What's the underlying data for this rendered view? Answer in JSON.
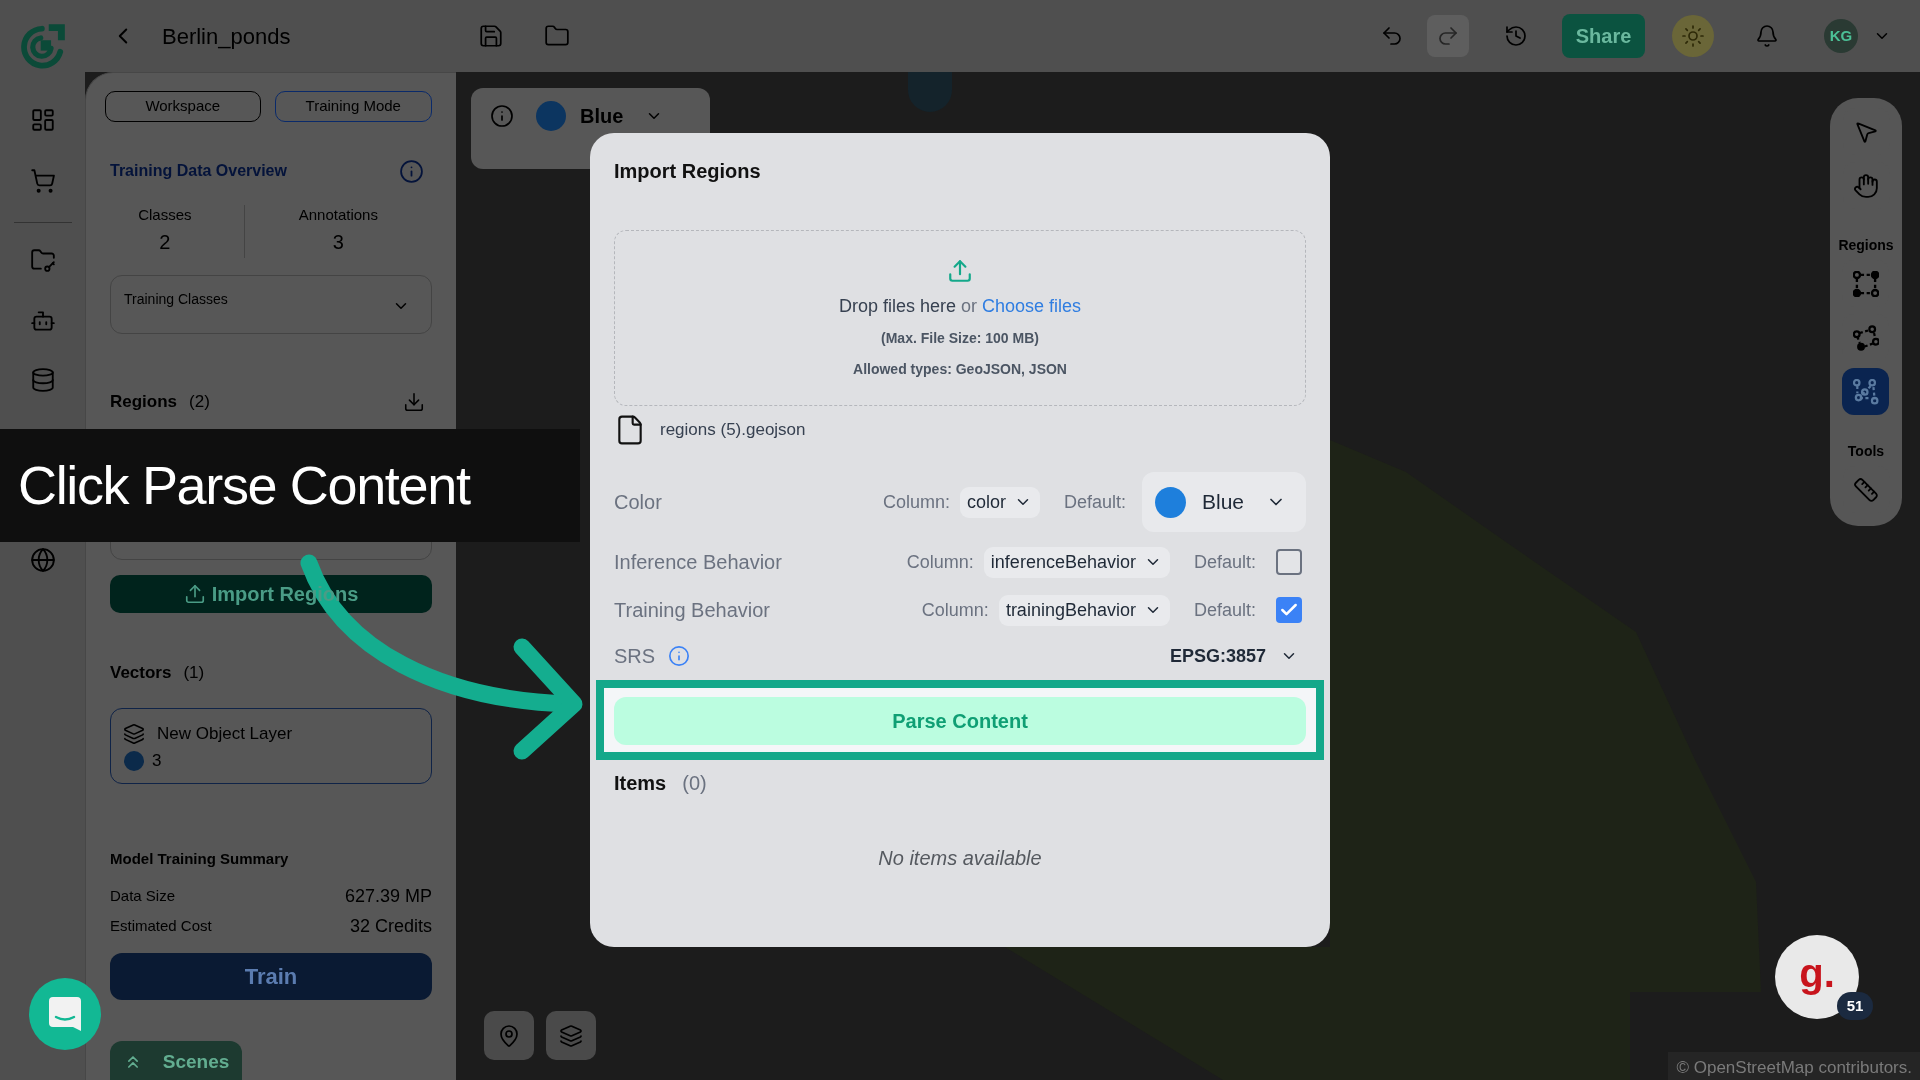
{
  "top_bar": {
    "project_title": "Berlin_ponds",
    "share_button": "Share",
    "user_initials": "KG"
  },
  "side_panel": {
    "mode_buttons": [
      {
        "label": "Workspace",
        "selected": false
      },
      {
        "label": "Training Mode",
        "selected": true
      }
    ],
    "overview": {
      "title": "Training Data Overview",
      "stats": [
        {
          "label": "Classes",
          "value": "2"
        },
        {
          "label": "Annotations",
          "value": "3"
        }
      ],
      "classes_dropdown": {
        "placeholder": "Training Classes"
      }
    },
    "regions": {
      "title": "Regions",
      "count": "(2)",
      "import_button": "Import Regions"
    },
    "vectors": {
      "title": "Vectors",
      "count": "(1)",
      "layers": [
        {
          "name": "New Object Layer",
          "count": "3",
          "color": "#0b2a4a"
        }
      ]
    },
    "summary": {
      "title": "Model Training Summary",
      "rows": [
        {
          "label": "Data Size",
          "value": "627.39 MP"
        },
        {
          "label": "Estimated Cost",
          "value": "32 Credits"
        }
      ],
      "train_button": "Train"
    },
    "scenes_tab": "Scenes"
  },
  "map": {
    "layer_chip": {
      "label": "Blue",
      "color": "#0c3560"
    },
    "toolbar": {
      "tools": [
        {
          "kind": "pointer",
          "selected": false
        },
        {
          "kind": "hand",
          "selected": false
        }
      ],
      "sections": [
        {
          "title": "Regions",
          "tools": [
            {
              "kind": "rectangle",
              "selected": false
            },
            {
              "kind": "polygon",
              "selected": false
            },
            {
              "kind": "freehand",
              "selected": true
            }
          ]
        },
        {
          "title": "Tools",
          "tools": [
            {
              "kind": "ruler",
              "selected": false
            }
          ]
        }
      ]
    },
    "attribution": "© OpenStreetMap contributors."
  },
  "modal": {
    "title": "Import Regions",
    "dropzone": {
      "prompt": "Drop files here",
      "or": "or",
      "link": "Choose files",
      "max_size": "(Max. File Size: 100 MB)",
      "allowed_types": "Allowed types: GeoJSON, JSON"
    },
    "file": "regions (5).geojson",
    "fields": [
      {
        "kind": "color",
        "label": "Color",
        "column_label": "Column:",
        "column": "color",
        "default_label": "Default:",
        "default": {
          "label": "Blue",
          "color": "#1e7fdc"
        }
      },
      {
        "kind": "checkbox",
        "label": "Inference Behavior",
        "column_label": "Column:",
        "column": "inferenceBehavior",
        "default_label": "Default:",
        "checked": false
      },
      {
        "kind": "checkbox",
        "label": "Training Behavior",
        "column_label": "Column:",
        "column": "trainingBehavior",
        "default_label": "Default:",
        "checked": true
      }
    ],
    "srs": {
      "label": "SRS",
      "value": "EPSG:3857"
    },
    "parse_button": "Parse Content",
    "items": {
      "title": "Items",
      "count": "(0)",
      "empty": "No items available"
    }
  },
  "tutorial": {
    "caption": "Click Parse Content"
  },
  "help_badge": {
    "logo": "g.",
    "count": "51"
  }
}
